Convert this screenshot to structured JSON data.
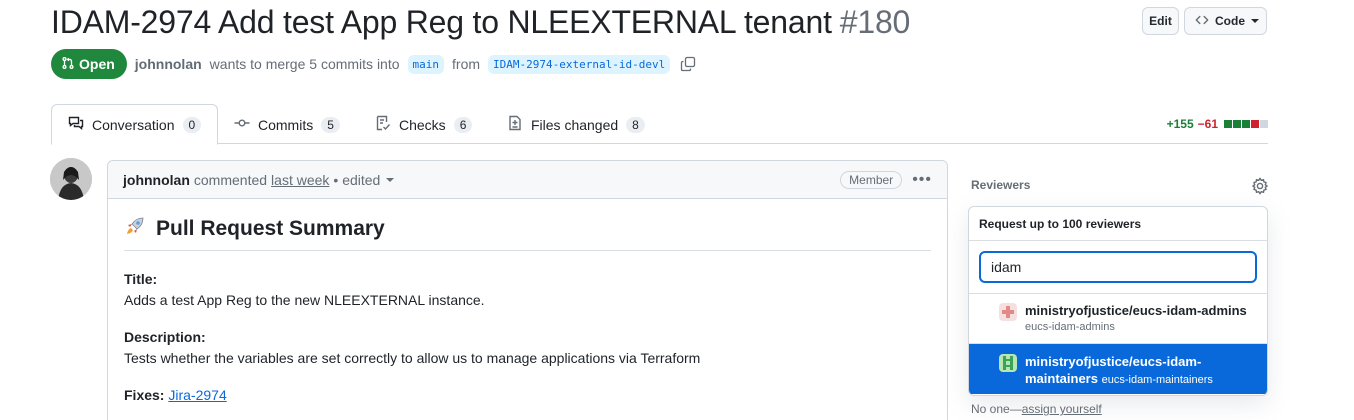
{
  "pr": {
    "title": "IDAM-2974 Add test App Reg to NLEEXTERNAL tenant",
    "number": "#180",
    "state": "Open",
    "author": "johnnolan",
    "merge_text": "wants to merge 5 commits into",
    "base_branch": "main",
    "from_text": "from",
    "head_branch": "IDAM-2974-external-id-devl"
  },
  "actions": {
    "edit_label": "Edit",
    "code_label": "Code"
  },
  "tabs": [
    {
      "label": "Conversation",
      "count": "0"
    },
    {
      "label": "Commits",
      "count": "5"
    },
    {
      "label": "Checks",
      "count": "6"
    },
    {
      "label": "Files changed",
      "count": "8"
    }
  ],
  "diffstat": {
    "additions": "+155",
    "deletions": "−61"
  },
  "comment": {
    "author": "johnnolan",
    "action": "commented",
    "time": "last week",
    "edited": "• edited",
    "role": "Member",
    "heading": "Pull Request Summary",
    "title_label": "Title:",
    "title_text": "Adds a test App Reg to the new NLEEXTERNAL instance.",
    "desc_label": "Description:",
    "desc_text": "Tests whether the variables are set correctly to allow us to manage applications via Terraform",
    "fixes_label": "Fixes:",
    "fixes_link": "Jira-2974"
  },
  "reviewers": {
    "title": "Reviewers",
    "popover_header": "Request up to 100 reviewers",
    "search_value": "idam",
    "options": [
      {
        "name": "ministryofjustice/eucs-idam-admins",
        "slug": "eucs-idam-admins"
      },
      {
        "name_line1": "ministryofjustice/eucs-idam-",
        "name_line2": "maintainers",
        "slug": "eucs-idam-maintainers"
      }
    ],
    "no_one": "No one—",
    "assign_yourself": "assign yourself"
  },
  "colors": {
    "accent": "#0969da",
    "open_green": "#1f883d",
    "add": "#1a7f37",
    "del": "#cf222e"
  }
}
